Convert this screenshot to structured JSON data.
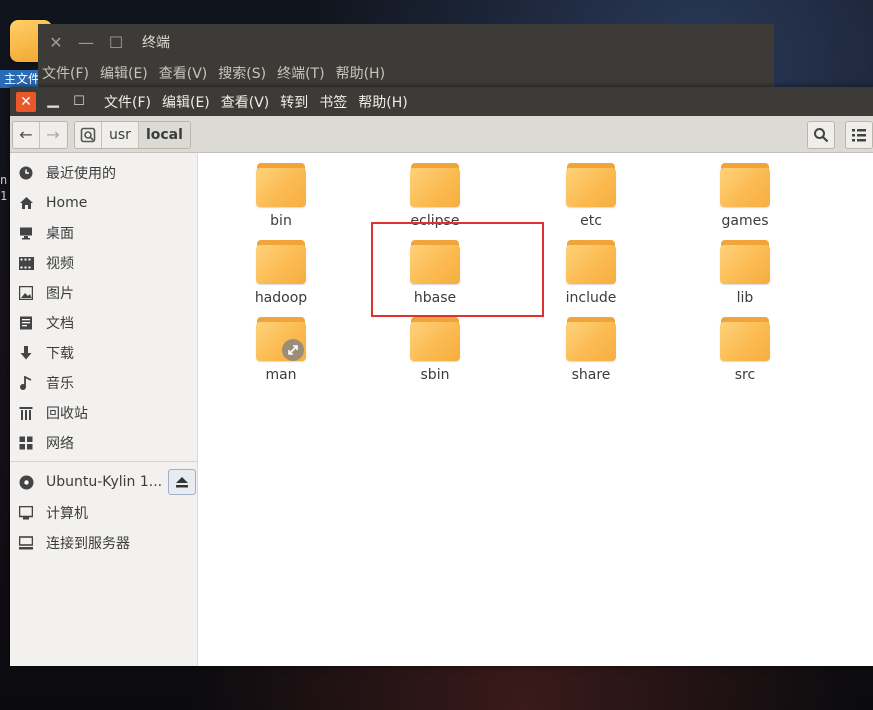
{
  "desktop": {
    "icon_label": "主文件夹",
    "terminal_side_text": [
      "n",
      "1"
    ]
  },
  "terminal": {
    "title": "终端",
    "menu": [
      "文件(F)",
      "编辑(E)",
      "查看(V)",
      "搜索(S)",
      "终端(T)",
      "帮助(H)"
    ]
  },
  "file_manager": {
    "menu": [
      "文件(F)",
      "编辑(E)",
      "查看(V)",
      "转到",
      "书签",
      "帮助(H)"
    ],
    "path": [
      "usr",
      "local"
    ],
    "sidebar": {
      "places": [
        {
          "label": "最近使用的",
          "icon": "clock-icon"
        },
        {
          "label": "Home",
          "icon": "home-icon"
        },
        {
          "label": "桌面",
          "icon": "desktop-icon"
        },
        {
          "label": "视频",
          "icon": "video-icon"
        },
        {
          "label": "图片",
          "icon": "picture-icon"
        },
        {
          "label": "文档",
          "icon": "document-icon"
        },
        {
          "label": "下载",
          "icon": "download-icon"
        },
        {
          "label": "音乐",
          "icon": "music-icon"
        },
        {
          "label": "回收站",
          "icon": "trash-icon"
        },
        {
          "label": "网络",
          "icon": "network-icon"
        }
      ],
      "devices": [
        {
          "label": "Ubuntu-Kylin 1...",
          "icon": "disc-icon"
        },
        {
          "label": "计算机",
          "icon": "computer-icon"
        },
        {
          "label": "连接到服务器",
          "icon": "server-icon"
        }
      ]
    },
    "folders": [
      "bin",
      "eclipse",
      "etc",
      "games",
      "hadoop",
      "hbase",
      "include",
      "lib",
      "man",
      "sbin",
      "share",
      "src"
    ],
    "highlighted_folder": "hbase",
    "colors": {
      "close_button": "#e9582a",
      "highlight_box": "#e0312e",
      "folder": "#fbbb52"
    }
  }
}
